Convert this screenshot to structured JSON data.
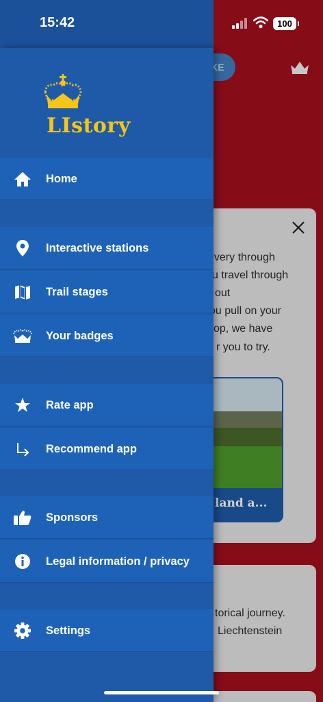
{
  "status_bar": {
    "time": "15:42",
    "battery": "100"
  },
  "drawer": {
    "app_name": "LIstory",
    "menu": [
      {
        "label": "Home",
        "icon": "home-icon"
      },
      {
        "label": "Interactive stations",
        "icon": "location-pin-icon"
      },
      {
        "label": "Trail stages",
        "icon": "map-icon"
      },
      {
        "label": "Your badges",
        "icon": "crown-icon"
      },
      {
        "label": "Rate app",
        "icon": "star-icon"
      },
      {
        "label": "Recommend app",
        "icon": "share-arrow-icon"
      },
      {
        "label": "Sponsors",
        "icon": "thumbs-up-icon"
      },
      {
        "label": "Legal information / privacy",
        "icon": "info-icon"
      },
      {
        "label": "Settings",
        "icon": "gear-icon"
      }
    ]
  },
  "background": {
    "pill_label": "KE",
    "card1_lines": [
      "overy through",
      "u travel through",
      "out",
      "ou pull on your",
      "op, we have",
      "r you to try."
    ],
    "mini_card_title": "land a...",
    "card2_lines": [
      "torical journey.",
      "Liechtenstein"
    ]
  },
  "colors": {
    "drawer": "#1e5aa8",
    "menu_item": "#1e62b8",
    "accent_gold": "#f5c518",
    "bg_red": "#a40f1e"
  }
}
